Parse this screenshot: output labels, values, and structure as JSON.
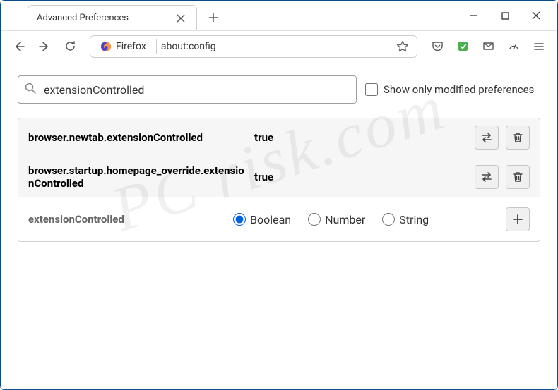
{
  "titlebar": {
    "tab_label": "Advanced Preferences"
  },
  "toolbar": {
    "identity_label": "Firefox",
    "url": "about:config"
  },
  "search": {
    "value": "extensionControlled",
    "modified_only_label": "Show only modified preferences"
  },
  "prefs": {
    "rows": [
      {
        "name": "browser.newtab.extensionControlled",
        "value": "true"
      },
      {
        "name": "browser.startup.homepage_override.extensionControlled",
        "value": "true"
      }
    ],
    "new_row": {
      "name": "extensionControlled",
      "types": [
        {
          "label": "Boolean",
          "checked": true
        },
        {
          "label": "Number",
          "checked": false
        },
        {
          "label": "String",
          "checked": false
        }
      ]
    }
  },
  "watermark": "PC risk.com"
}
